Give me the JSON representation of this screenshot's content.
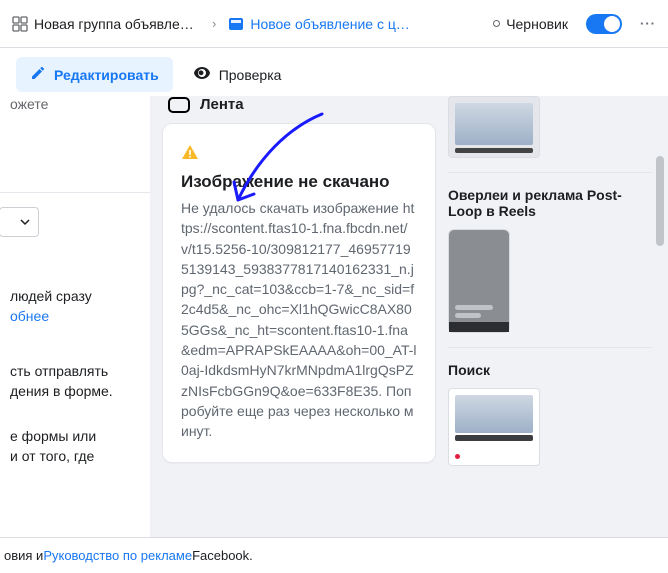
{
  "breadcrumb": {
    "group_label": "Новая группа объявлений с",
    "ad_label": "Новое объявление с целью '"
  },
  "status_label": "Черновик",
  "tabs": {
    "edit": "Редактировать",
    "check": "Проверка"
  },
  "left": {
    "top_fragment": "ожете",
    "audience_fragment_1": "людей сразу",
    "audience_link": "обнее",
    "form_fragment_1": "сть отправлять",
    "form_fragment_2": "дения в форме.",
    "form_fragment_3": "е формы или",
    "form_fragment_4": "и от того, где"
  },
  "feed": {
    "title": "Лента"
  },
  "error": {
    "title": "Изображение не скачано",
    "body": "Не удалось скачать изображение https://scontent.ftas10-1.fna.fbcdn.net/v/t15.5256-10/309812177_469577195139143_5938377817140162331_n.jpg?_nc_cat=103&ccb=1-7&_nc_sid=f2c4d5&_nc_ohc=Xl1hQGwicC8AX805GGs&_nc_ht=scontent.ftas10-1.fna&edm=APRAPSkEAAAA&oh=00_AT-l0aj-IdkdsmHyN7krMNpdmA1lrgQsPZzNIsFcbGGn9Q&oe=633F8E35. Попробуйте еще раз через несколько минут."
  },
  "right": {
    "overlays_title": "Оверлеи и реклама Post-Loop в Reels",
    "search_title": "Поиск"
  },
  "footer": {
    "text_1": "овия и ",
    "link": "Руководство по рекламе",
    "text_2": " Facebook."
  }
}
